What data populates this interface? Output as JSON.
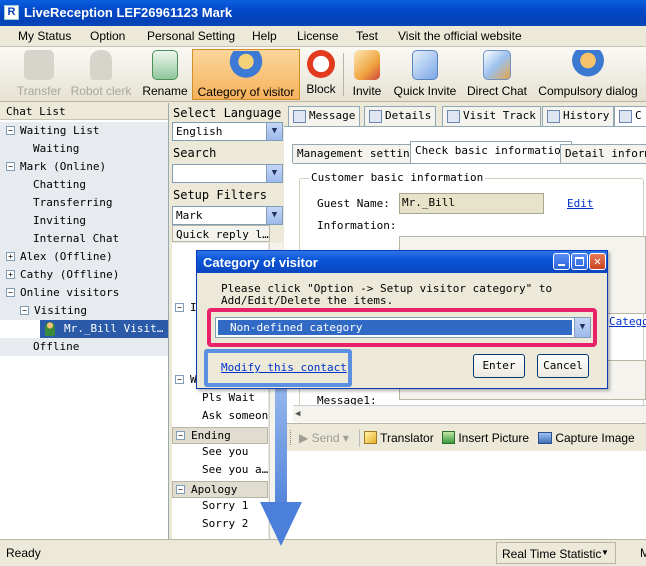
{
  "window": {
    "title": "LiveReception   LEF26961123 Mark",
    "app_icon": "R"
  },
  "menu": [
    "My Status",
    "Option",
    "Personal Setting",
    "Help",
    "License",
    "Test",
    "Visit the official website"
  ],
  "toolbar": {
    "transfer": "Transfer",
    "robot_clerk": "Robot clerk",
    "rename": "Rename",
    "category": "Category of visitor",
    "block": "Block",
    "invite": "Invite",
    "quick_invite": "Quick Invite",
    "direct_chat": "Direct Chat",
    "compulsory": "Compulsory dialog"
  },
  "chat_list": {
    "header": "Chat List",
    "items": [
      {
        "label": "Waiting List",
        "expander": "−"
      },
      {
        "label": "Waiting"
      },
      {
        "label": "Mark (Online)",
        "expander": "−"
      },
      {
        "label": "Chatting"
      },
      {
        "label": "Transferring"
      },
      {
        "label": "Inviting"
      },
      {
        "label": "Internal Chat"
      },
      {
        "label": "Alex (Offline)",
        "expander": "+"
      },
      {
        "label": "Cathy (Offline)",
        "expander": "+"
      },
      {
        "label": "Online visitors",
        "expander": "−"
      },
      {
        "label": "Visiting",
        "expander": "−"
      },
      {
        "label": "Mr._Bill  Visit…"
      },
      {
        "label": "Offline"
      }
    ]
  },
  "middle": {
    "select_language_label": "Select Language",
    "language_value": "English",
    "search_label": "Search",
    "search_value": "",
    "setup_filters_label": "Setup Filters",
    "filter_value": "Mark",
    "quick_reply_label": "Quick reply l…",
    "group1_initial": "I",
    "group2_initial": "W",
    "wait_items": [
      "Pls Wait",
      "Ask someone"
    ],
    "ending_header": "Ending",
    "ending_items": [
      "See you",
      "See you a…"
    ],
    "apology_header": "Apology",
    "apology_items": [
      "Sorry 1",
      "Sorry 2"
    ]
  },
  "tabs": [
    "Message",
    "Details",
    "Visit Track",
    "History",
    "C"
  ],
  "subtabs": [
    "Management setting",
    "Check basic information",
    "Detail inform"
  ],
  "customer": {
    "section_title": "Customer basic information",
    "guest_name_label": "Guest Name:",
    "guest_name_value": "Mr._Bill",
    "edit_link": "Edit",
    "information_label": "Information:",
    "message_label": "Message1:",
    "partial_link": "Catego"
  },
  "send_bar": {
    "send": "Send",
    "translator": "Translator",
    "insert_picture": "Insert Picture",
    "capture_image": "Capture Image"
  },
  "status": {
    "ready": "Ready",
    "statistic": "Real Time Statistic",
    "right_char": "M"
  },
  "dialog": {
    "title": "Category of visitor",
    "instructions_line1": "Please click \"Option -> Setup visitor category\" to",
    "instructions_line2": "Add/Edit/Delete the items.",
    "category_value": "Non-defined category",
    "modify_link": "Modify this contact",
    "enter_button": "Enter",
    "cancel_button": "Cancel"
  },
  "colors": {
    "title_bar": "#0348c8",
    "highlight_pink": "#e8226a",
    "highlight_blue": "#5b8fe0",
    "selection": "#316ac5"
  }
}
